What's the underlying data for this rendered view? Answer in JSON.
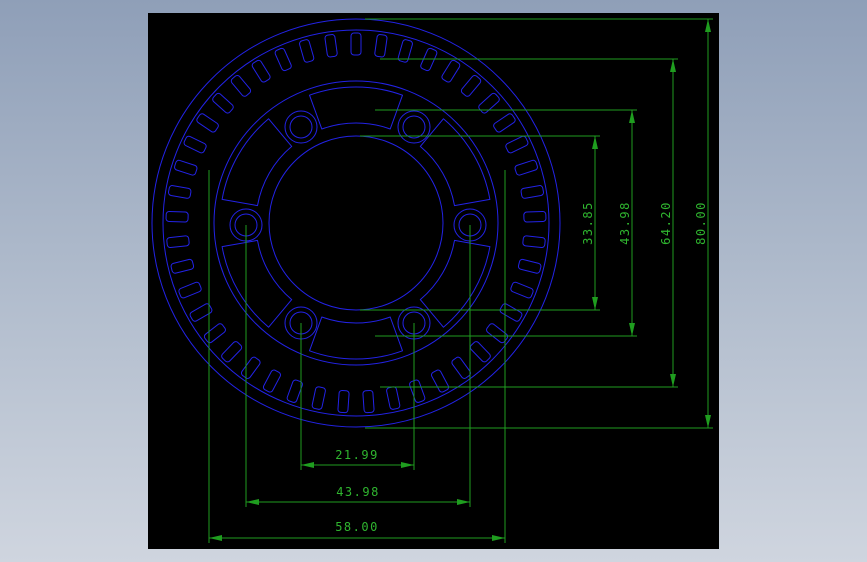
{
  "colors": {
    "background": "#000000",
    "geometry": "#2323e6",
    "dimension": "#1f9d1f",
    "dimension_text": "#2fb52f"
  },
  "drawing": {
    "slot_count": 45,
    "bolt_hole_count": 6
  },
  "dimensions": {
    "vertical": [
      {
        "label": "33.85"
      },
      {
        "label": "43.98"
      },
      {
        "label": "64.20"
      },
      {
        "label": "80.00"
      }
    ],
    "horizontal": [
      {
        "label": "21.99"
      },
      {
        "label": "43.98"
      },
      {
        "label": "58.00"
      }
    ]
  }
}
